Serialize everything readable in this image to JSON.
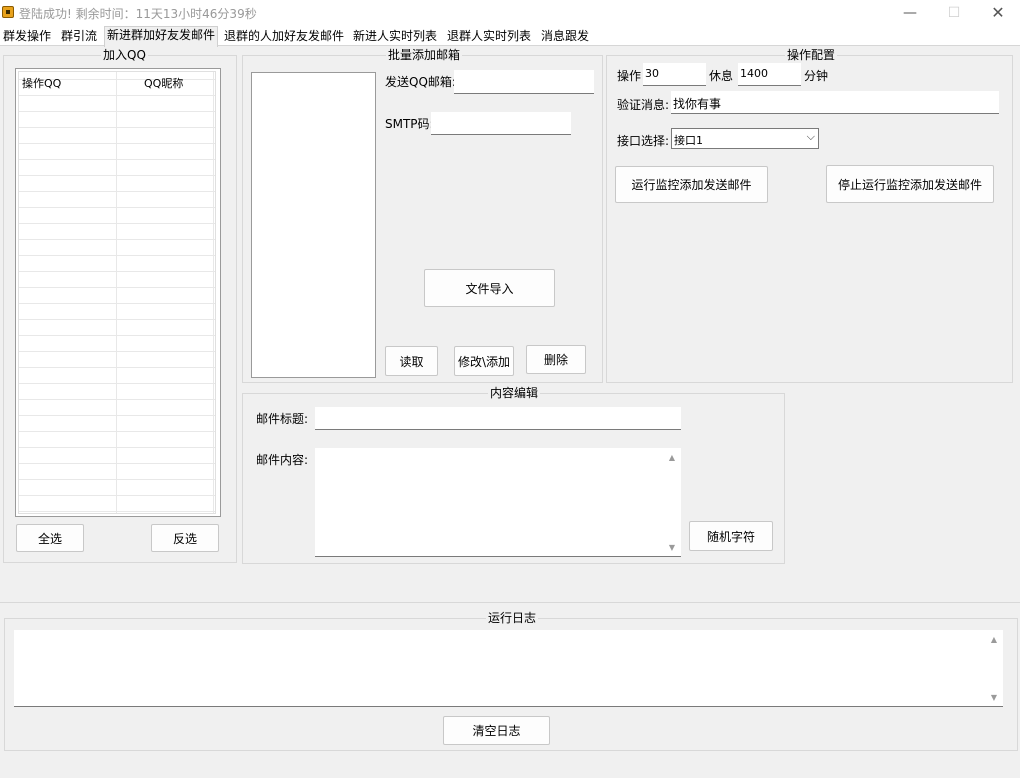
{
  "window": {
    "title": "登陆成功! 剩余时间：11天13小时46分39秒",
    "min_glyph": "—",
    "max_glyph": "☐",
    "close_glyph": "✕"
  },
  "tabs": [
    {
      "label": "群发操作",
      "active": false
    },
    {
      "label": "群引流",
      "active": false
    },
    {
      "label": "新进群加好友发邮件",
      "active": true
    },
    {
      "label": "退群的人加好友发邮件",
      "active": false
    },
    {
      "label": "新进人实时列表",
      "active": false
    },
    {
      "label": "退群人实时列表",
      "active": false
    },
    {
      "label": "消息跟发",
      "active": false
    }
  ],
  "join_qq": {
    "title": "加入QQ",
    "columns": [
      "操作QQ",
      "QQ昵称"
    ],
    "select_all": "全选",
    "invert": "反选"
  },
  "batch_email": {
    "title": "批量添加邮箱",
    "send_email_label": "发送QQ邮箱:",
    "send_email_value": "",
    "smtp_label": "SMTP码:",
    "smtp_value": "",
    "import_button": "文件导入",
    "read_button": "读取",
    "modify_button": "修改\\添加",
    "delete_button": "删除"
  },
  "config": {
    "title": "操作配置",
    "op_label": "操作",
    "op_value": "30",
    "rest_label": "休息",
    "rest_value": "1400",
    "minutes_label": "分钟",
    "verify_label": "验证消息:",
    "verify_value": "找你有事",
    "interface_label": "接口选择:",
    "interface_value": "接口1",
    "run_button": "运行监控添加发送邮件",
    "stop_button": "停止运行监控添加发送邮件"
  },
  "content": {
    "title": "内容编辑",
    "subject_label": "邮件标题:",
    "subject_value": "",
    "body_label": "邮件内容:",
    "random_button": "随机字符"
  },
  "log": {
    "title": "运行日志",
    "clear_button": "清空日志"
  },
  "colors": {
    "accent": "#e8a21c",
    "panel": "#f0f0f0"
  }
}
